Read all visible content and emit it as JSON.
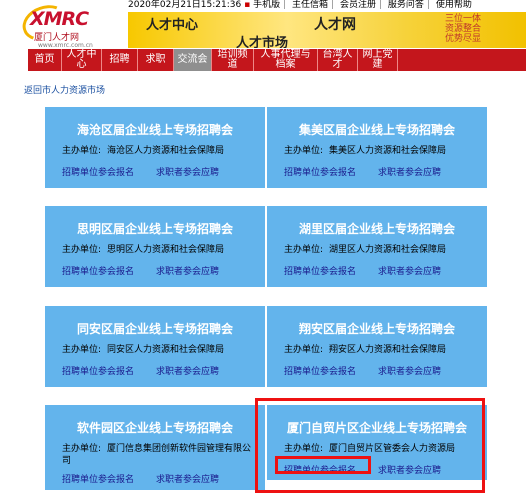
{
  "header": {
    "logo_word": "XMRC",
    "logo_cn": "厦门人才网",
    "logo_url": "www.xmrc.com.cn",
    "datetime": "2020年02月21日15:21:36",
    "top_links": [
      "手机版",
      "主任信箱",
      "会员注册",
      "服务问答",
      "使用帮助"
    ],
    "banner": {
      "line1": "人才中心",
      "line2": "人才市场",
      "line3": "人才网",
      "slogan": [
        "三位一体",
        "资源整合",
        "优势尽显"
      ]
    }
  },
  "nav": [
    "首页",
    "人才中心",
    "招聘",
    "求职",
    "交流会",
    "培训频道",
    "人事代理与档案",
    "台湾人才",
    "网上党建"
  ],
  "breadcrumb": "返回市人力资源市场",
  "org_label": "主办单位:",
  "link_employer": "招聘单位参会报名",
  "link_seeker": "求职者参会应聘",
  "cards": [
    {
      "title": "海沧区届企业线上专场招聘会",
      "org": "海沧区人力资源和社会保障局"
    },
    {
      "title": "集美区届企业线上专场招聘会",
      "org": "集美区人力资源和社会保障局"
    },
    {
      "title": "思明区届企业线上专场招聘会",
      "org": "思明区人力资源和社会保障局"
    },
    {
      "title": "湖里区届企业线上专场招聘会",
      "org": "湖里区人力资源和社会保障局"
    },
    {
      "title": "同安区届企业线上专场招聘会",
      "org": "同安区人力资源和社会保障局"
    },
    {
      "title": "翔安区届企业线上专场招聘会",
      "org": "翔安区人力资源和社会保障局"
    },
    {
      "title": "软件园区企业线上专场招聘会",
      "org": "厦门信息集团创新软件园管理有限公司"
    },
    {
      "title": "厦门自贸片区企业线上专场招聘会",
      "org": "厦门自贸片区管委会人力资源局"
    }
  ],
  "colors": {
    "nav_red": "#c4161c",
    "card_blue": "#63b4ec",
    "highlight": "#ee1111",
    "banner_yellow": "#f7c800"
  }
}
